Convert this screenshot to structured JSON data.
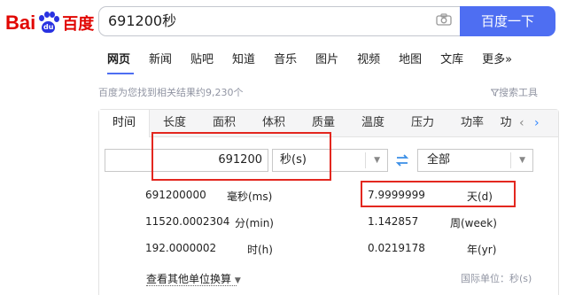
{
  "header": {
    "logo": {
      "latin": "Bai",
      "paw_text": "du",
      "chinese": "百度"
    },
    "search_value": "691200秒",
    "search_button": "百度一下"
  },
  "nav": {
    "items": [
      "网页",
      "新闻",
      "贴吧",
      "知道",
      "音乐",
      "图片",
      "视频",
      "地图",
      "文库",
      "更多»"
    ],
    "active": "网页"
  },
  "result_count": "百度为您找到相关结果约9,230个",
  "tools_label": "搜索工具",
  "converter": {
    "tabs": [
      "时间",
      "长度",
      "面积",
      "体积",
      "质量",
      "温度",
      "压力",
      "功率",
      "功"
    ],
    "active_tab": "时间",
    "input_value": "691200",
    "input_unit": "秒(s)",
    "target_unit": "全部",
    "rows": [
      {
        "value": "691200000",
        "unit": "毫秒(ms)"
      },
      {
        "value": "7.9999999",
        "unit": "天(d)"
      },
      {
        "value": "11520.0002304",
        "unit": "分(min)"
      },
      {
        "value": "1.142857",
        "unit": "周(week)"
      },
      {
        "value": "192.0000002",
        "unit": "时(h)"
      },
      {
        "value": "0.0219178",
        "unit": "年(yr)"
      }
    ],
    "more_link": "查看其他单位换算",
    "standard_label": "国际单位：秒(s)"
  },
  "colors": {
    "accent": "#4e6ef2",
    "logo_red": "#e10602",
    "logo_blue": "#2932e1",
    "annotation_red": "#e3271f"
  },
  "icons": {
    "camera": "camera-icon",
    "swap": "swap-icon",
    "filter": "filter-icon"
  }
}
